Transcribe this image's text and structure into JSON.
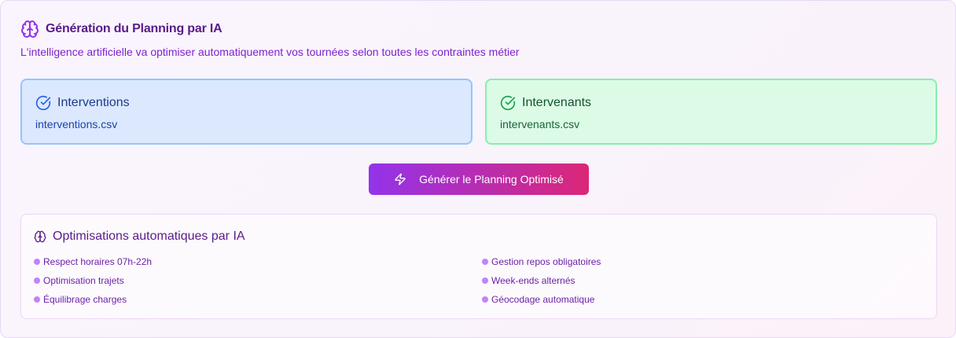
{
  "header": {
    "title": "Génération du Planning par IA",
    "subtitle": "L'intelligence artificielle va optimiser automatiquement vos tournées selon toutes les contraintes métier"
  },
  "files": {
    "interventions": {
      "title": "Interventions",
      "filename": "interventions.csv"
    },
    "intervenants": {
      "title": "Intervenants",
      "filename": "intervenants.csv"
    }
  },
  "generate_button": {
    "label": "Générer le Planning Optimisé"
  },
  "optimisations": {
    "title": "Optimisations automatiques par IA",
    "left": [
      "Respect horaires 07h-22h",
      "Optimisation trajets",
      "Équilibrage charges"
    ],
    "right": [
      "Gestion repos obligatoires",
      "Week-ends alternés",
      "Géocodage automatique"
    ]
  },
  "icons": {
    "header": "brain-icon",
    "interventions": "check-circle-icon",
    "intervenants": "check-circle-icon",
    "button": "zap-icon",
    "optimisations": "brain-icon"
  },
  "colors": {
    "accent_purple": "#9333ea",
    "accent_pink": "#db2777",
    "interventions_bg": "#dbe8fd",
    "intervenants_bg": "#dcfbe7"
  }
}
